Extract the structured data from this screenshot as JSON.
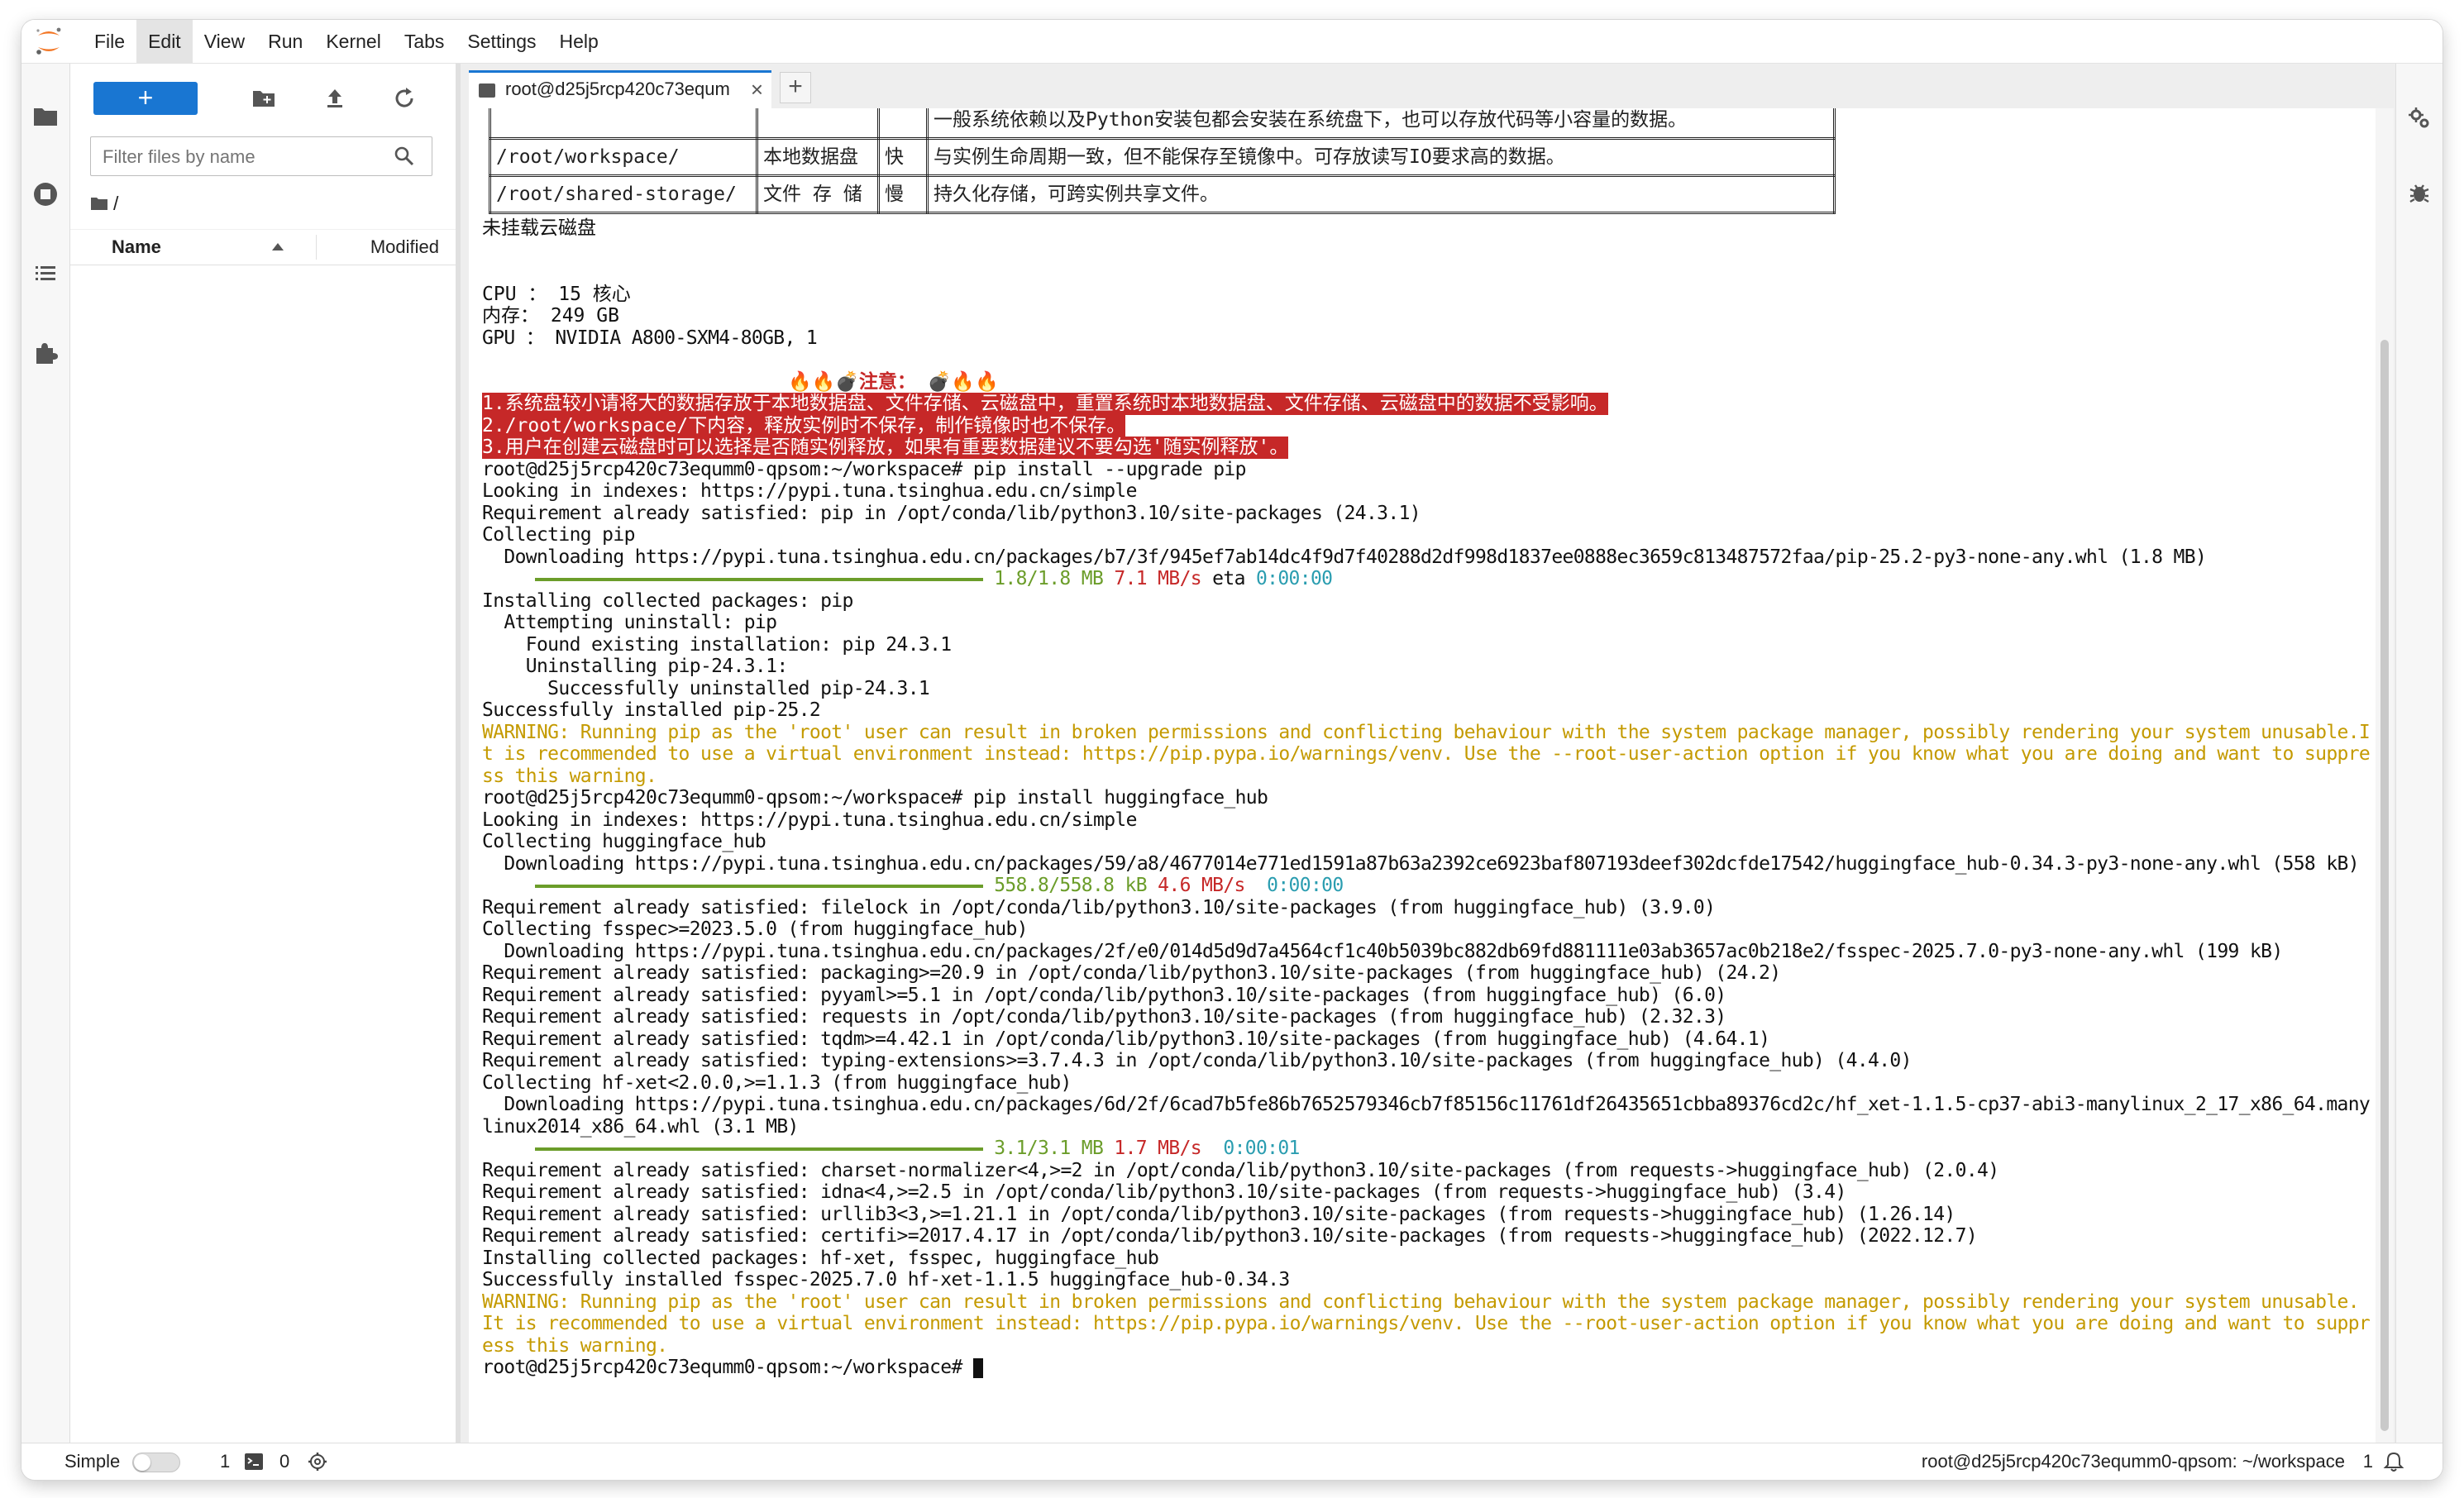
{
  "app": {
    "menu": [
      "File",
      "Edit",
      "View",
      "Run",
      "Kernel",
      "Tabs",
      "Settings",
      "Help"
    ],
    "active_menu": "Edit"
  },
  "file_browser": {
    "new_button_label": "+",
    "filter_placeholder": "Filter files by name",
    "path": "/",
    "column_name": "Name",
    "column_modified": "Modified"
  },
  "tabs": [
    {
      "label": "root@d25j5rcp420c73equm",
      "close": "×"
    }
  ],
  "tab_add_label": "+",
  "storage_table": {
    "rows": [
      [
        "",
        "",
        "",
        "一般系统依赖以及Python安装包都会安装在系统盘下，也可以存放代码等小容量的数据。"
      ],
      [
        "/root/workspace/",
        "本地数据盘",
        "快",
        "与实例生命周期一致，但不能保存至镜像中。可存放读写IO要求高的数据。"
      ],
      [
        "/root/shared-storage/",
        "文件 存 储",
        "慢",
        "持久化存储，可跨实例共享文件。"
      ]
    ]
  },
  "terminal": {
    "no_cloud_disk": "未挂载云磁盘",
    "cpu": "CPU ： 15 核心",
    "mem": "内存： 249 GB",
    "gpu": "GPU ： NVIDIA A800-SXM4-80GB, 1",
    "notice_title": "🔥🔥💣注意： 💣🔥🔥",
    "notice_1": "1.系统盘较小请将大的数据存放于本地数据盘、文件存储、云磁盘中，重置系统时本地数据盘、文件存储、云磁盘中的数据不受影响。",
    "notice_2": "2./root/workspace/下内容，释放实例时不保存，制作镜像时也不保存。",
    "notice_3": "3.用户在创建云磁盘时可以选择是否随实例释放，如果有重要数据建议不要勾选'随实例释放'。",
    "l01": "root@d25j5rcp420c73equmm0-qpsom:~/workspace# pip install --upgrade pip",
    "l02": "Looking in indexes: https://pypi.tuna.tsinghua.edu.cn/simple",
    "l03": "Requirement already satisfied: pip in /opt/conda/lib/python3.10/site-packages (24.3.1)",
    "l04": "Collecting pip",
    "l05": "  Downloading https://pypi.tuna.tsinghua.edu.cn/packages/b7/3f/945ef7ab14dc4f9d7f40288d2df998d1837ee0888ec3659c813487572faa/pip-25.2-py3-none-any.whl (1.8 MB)",
    "p1_size": "1.8/1.8 MB",
    "p1_speed": "7.1 MB/s",
    "p1_eta_label": "eta",
    "p1_eta": "0:00:00",
    "l06": "Installing collected packages: pip",
    "l07": "  Attempting uninstall: pip",
    "l08": "    Found existing installation: pip 24.3.1",
    "l09": "    Uninstalling pip-24.3.1:",
    "l10": "      Successfully uninstalled pip-24.3.1",
    "l11": "Successfully installed pip-25.2",
    "w1a": "WARNING: Running pip as the 'root' user can result in broken permissions and conflicting behaviour with the system package manager, possibly rendering your system unusable.I",
    "w1b": "t is recommended to use a virtual environment instead: https://pip.pypa.io/warnings/venv. Use the --root-user-action option if you know what you are doing and want to suppre",
    "w1c": "ss this warning.",
    "l12": "root@d25j5rcp420c73equmm0-qpsom:~/workspace# pip install huggingface_hub",
    "l13": "Looking in indexes: https://pypi.tuna.tsinghua.edu.cn/simple",
    "l14": "Collecting huggingface_hub",
    "l15": "  Downloading https://pypi.tuna.tsinghua.edu.cn/packages/59/a8/4677014e771ed1591a87b63a2392ce6923baf807193deef302dcfde17542/huggingface_hub-0.34.3-py3-none-any.whl (558 kB)",
    "p2_size": "558.8/558.8 kB",
    "p2_speed": "4.6 MB/s",
    "p2_eta": "0:00:00",
    "l16": "Requirement already satisfied: filelock in /opt/conda/lib/python3.10/site-packages (from huggingface_hub) (3.9.0)",
    "l17": "Collecting fsspec>=2023.5.0 (from huggingface_hub)",
    "l18": "  Downloading https://pypi.tuna.tsinghua.edu.cn/packages/2f/e0/014d5d9d7a4564cf1c40b5039bc882db69fd881111e03ab3657ac0b218e2/fsspec-2025.7.0-py3-none-any.whl (199 kB)",
    "l19": "Requirement already satisfied: packaging>=20.9 in /opt/conda/lib/python3.10/site-packages (from huggingface_hub) (24.2)",
    "l20": "Requirement already satisfied: pyyaml>=5.1 in /opt/conda/lib/python3.10/site-packages (from huggingface_hub) (6.0)",
    "l21": "Requirement already satisfied: requests in /opt/conda/lib/python3.10/site-packages (from huggingface_hub) (2.32.3)",
    "l22": "Requirement already satisfied: tqdm>=4.42.1 in /opt/conda/lib/python3.10/site-packages (from huggingface_hub) (4.64.1)",
    "l23": "Requirement already satisfied: typing-extensions>=3.7.4.3 in /opt/conda/lib/python3.10/site-packages (from huggingface_hub) (4.4.0)",
    "l24": "Collecting hf-xet<2.0.0,>=1.1.3 (from huggingface_hub)",
    "l25": "  Downloading https://pypi.tuna.tsinghua.edu.cn/packages/6d/2f/6cad7b5fe86b7652579346cb7f85156c11761df26435651cbba89376cd2c/hf_xet-1.1.5-cp37-abi3-manylinux_2_17_x86_64.many",
    "l26": "linux2014_x86_64.whl (3.1 MB)",
    "p3_size": "3.1/3.1 MB",
    "p3_speed": "1.7 MB/s",
    "p3_eta": "0:00:01",
    "l27": "Requirement already satisfied: charset-normalizer<4,>=2 in /opt/conda/lib/python3.10/site-packages (from requests->huggingface_hub) (2.0.4)",
    "l28": "Requirement already satisfied: idna<4,>=2.5 in /opt/conda/lib/python3.10/site-packages (from requests->huggingface_hub) (3.4)",
    "l29": "Requirement already satisfied: urllib3<3,>=1.21.1 in /opt/conda/lib/python3.10/site-packages (from requests->huggingface_hub) (1.26.14)",
    "l30": "Requirement already satisfied: certifi>=2017.4.17 in /opt/conda/lib/python3.10/site-packages (from requests->huggingface_hub) (2022.12.7)",
    "l31": "Installing collected packages: hf-xet, fsspec, huggingface_hub",
    "l32": "Successfully installed fsspec-2025.7.0 hf-xet-1.1.5 huggingface_hub-0.34.3",
    "w2a": "WARNING: Running pip as the 'root' user can result in broken permissions and conflicting behaviour with the system package manager, possibly rendering your system unusable.",
    "w2b": "It is recommended to use a virtual environment instead: https://pip.pypa.io/warnings/venv. Use the --root-user-action option if you know what you are doing and want to suppr",
    "w2c": "ess this warning.",
    "prompt": "root@d25j5rcp420c73equmm0-qpsom:~/workspace# "
  },
  "status_bar": {
    "mode_label": "Simple",
    "terminal_count": "1",
    "kernel_count": "0",
    "right_text": "root@d25j5rcp420c73equmm0-qpsom: ~/workspace",
    "notification_count": "1"
  },
  "colors": {
    "accent": "#1976d2",
    "warning_text": "#c49a00",
    "progress_green": "#6b9d2a",
    "speed_red": "#c62828",
    "eta_cyan": "#2a9db0",
    "notice_bg": "#c62828"
  },
  "icons": {
    "left": [
      "folder-icon",
      "running-sessions-icon",
      "table-of-contents-icon",
      "extensions-icon"
    ],
    "file_tools": [
      "new-folder-icon",
      "upload-icon",
      "refresh-icon"
    ],
    "right": [
      "property-inspector-icon",
      "debugger-icon"
    ]
  }
}
